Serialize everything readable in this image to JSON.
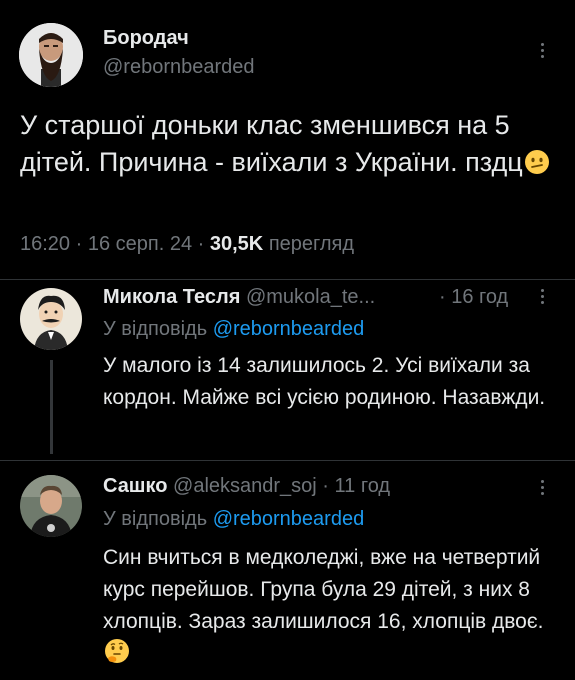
{
  "main_tweet": {
    "author_name": "Бородач",
    "author_handle": "@rebornbearded",
    "text": "У старшої доньки клас зменшився на 5 дітей. Причина - виїхали з України. пздц",
    "time": "16:20",
    "date": "16 серп. 24",
    "views_count": "30,5K",
    "views_label": "перегляд",
    "separator": " · ",
    "emoji": "confused-face"
  },
  "replies": [
    {
      "author_name": "Микола Тесля",
      "author_handle": "@mukola_te...",
      "time_ago": "· 16 год",
      "reply_to_label": "У відповідь",
      "reply_to_handle": "@rebornbearded",
      "text": "У малого із 14 залишилось 2. Усі виїхали за кордон. Майже всі усією родиною. Назавжди."
    },
    {
      "author_name": "Сашко",
      "author_handle": "@aleksandr_soj",
      "time_ago": "· 11 год",
      "reply_to_label": "У відповідь",
      "reply_to_handle": "@rebornbearded",
      "text": "Син вчиться в медколеджі, вже на четвертий курс перейшов. Група була 29 дітей, з них 8 хлопців. Зараз залишилося 16, хлопців двоє.",
      "emoji": "thinking-face"
    }
  ],
  "colors": {
    "background": "#000000",
    "text": "#e7e9ea",
    "muted": "#71767b",
    "link": "#1d9bf0",
    "divider": "#2f3336"
  }
}
